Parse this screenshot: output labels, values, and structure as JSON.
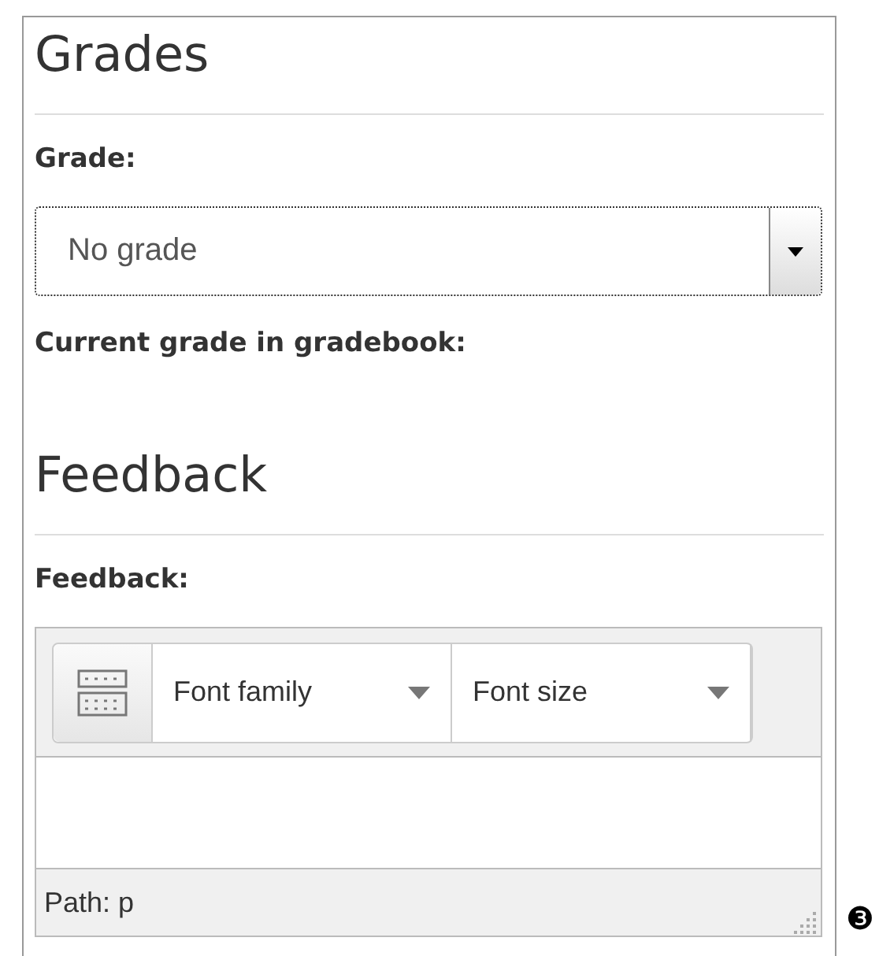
{
  "sections": [
    {
      "heading": "Grades",
      "fields": [
        {
          "kind": "select",
          "label": "Grade:",
          "value": "No grade",
          "focused": true
        },
        {
          "kind": "static",
          "label": "Current grade in gradebook:"
        }
      ]
    },
    {
      "heading": "Feedback",
      "fields": [
        {
          "kind": "editor",
          "label": "Feedback:",
          "toolbar": [
            "Font family",
            "Font size"
          ],
          "path": "Path: p"
        }
      ]
    }
  ],
  "callout": "❸"
}
